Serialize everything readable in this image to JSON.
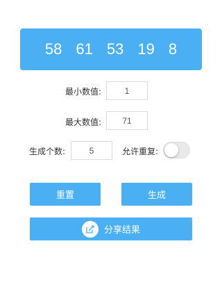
{
  "result": {
    "numbers": [
      "58",
      "61",
      "53",
      "19",
      "8"
    ]
  },
  "form": {
    "min_label": "最小数值:",
    "min_value": "1",
    "max_label": "最大数值:",
    "max_value": "71",
    "count_label": "生成个数:",
    "count_value": "5",
    "allow_repeat_label": "允许重复:",
    "allow_repeat_on": false
  },
  "buttons": {
    "reset_label": "重置",
    "generate_label": "生成",
    "share_label": "分享结果"
  },
  "colors": {
    "accent": "#4bb0f3",
    "toggle_off": "#e9e9ea"
  },
  "icons": {
    "share": "share-edit-icon"
  }
}
